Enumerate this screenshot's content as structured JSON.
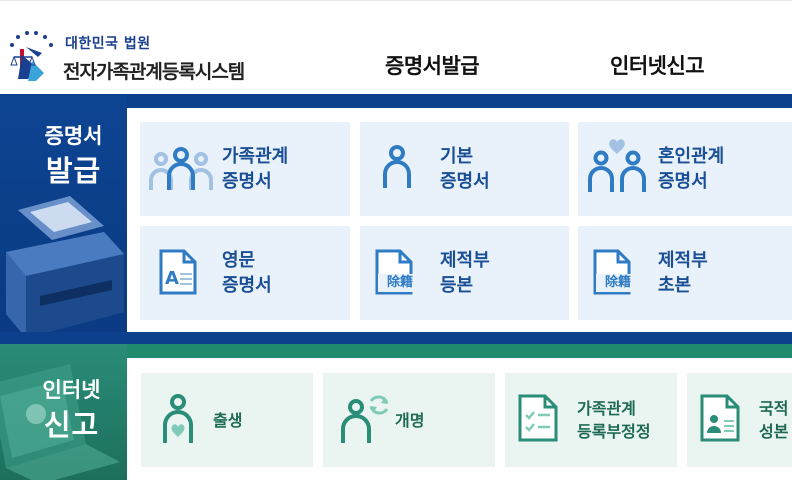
{
  "header": {
    "court_name": "대한민국 법원",
    "system_name": "전자가족관계등록시스템",
    "nav": [
      {
        "label": "증명서발급"
      },
      {
        "label": "인터넷신고"
      }
    ]
  },
  "certificates": {
    "side_line1": "증명서",
    "side_line2": "발급",
    "items": [
      {
        "line1": "가족관계",
        "line2": "증명서",
        "icon": "family-icon"
      },
      {
        "line1": "기본",
        "line2": "증명서",
        "icon": "person-icon"
      },
      {
        "line1": "혼인관계",
        "line2": "증명서",
        "icon": "couple-heart-icon"
      },
      {
        "line1": "영문",
        "line2": "증명서",
        "icon": "english-document-icon"
      },
      {
        "line1": "제적부",
        "line2": "등본",
        "icon": "removed-register-document-icon",
        "stamp": "除籍"
      },
      {
        "line1": "제적부",
        "line2": "초본",
        "icon": "removed-register-document-icon",
        "stamp": "除籍"
      }
    ]
  },
  "reports": {
    "side_line1": "인터넷",
    "side_line2": "신고",
    "items": [
      {
        "line1": "출생",
        "line2": "",
        "icon": "birth-icon"
      },
      {
        "line1": "개명",
        "line2": "",
        "icon": "rename-icon"
      },
      {
        "line1": "가족관계",
        "line2": "등록부정정",
        "icon": "checklist-document-icon"
      },
      {
        "line1": "국적",
        "line2": "성본",
        "icon": "id-document-icon"
      }
    ]
  },
  "colors": {
    "blue_band": "#0c3f8c",
    "blue_card": "#e9f1fa",
    "blue_text": "#1a4f96",
    "green_band": "#1f8a6d",
    "green_card": "#eaf4f1",
    "green_text": "#1e6a55"
  }
}
